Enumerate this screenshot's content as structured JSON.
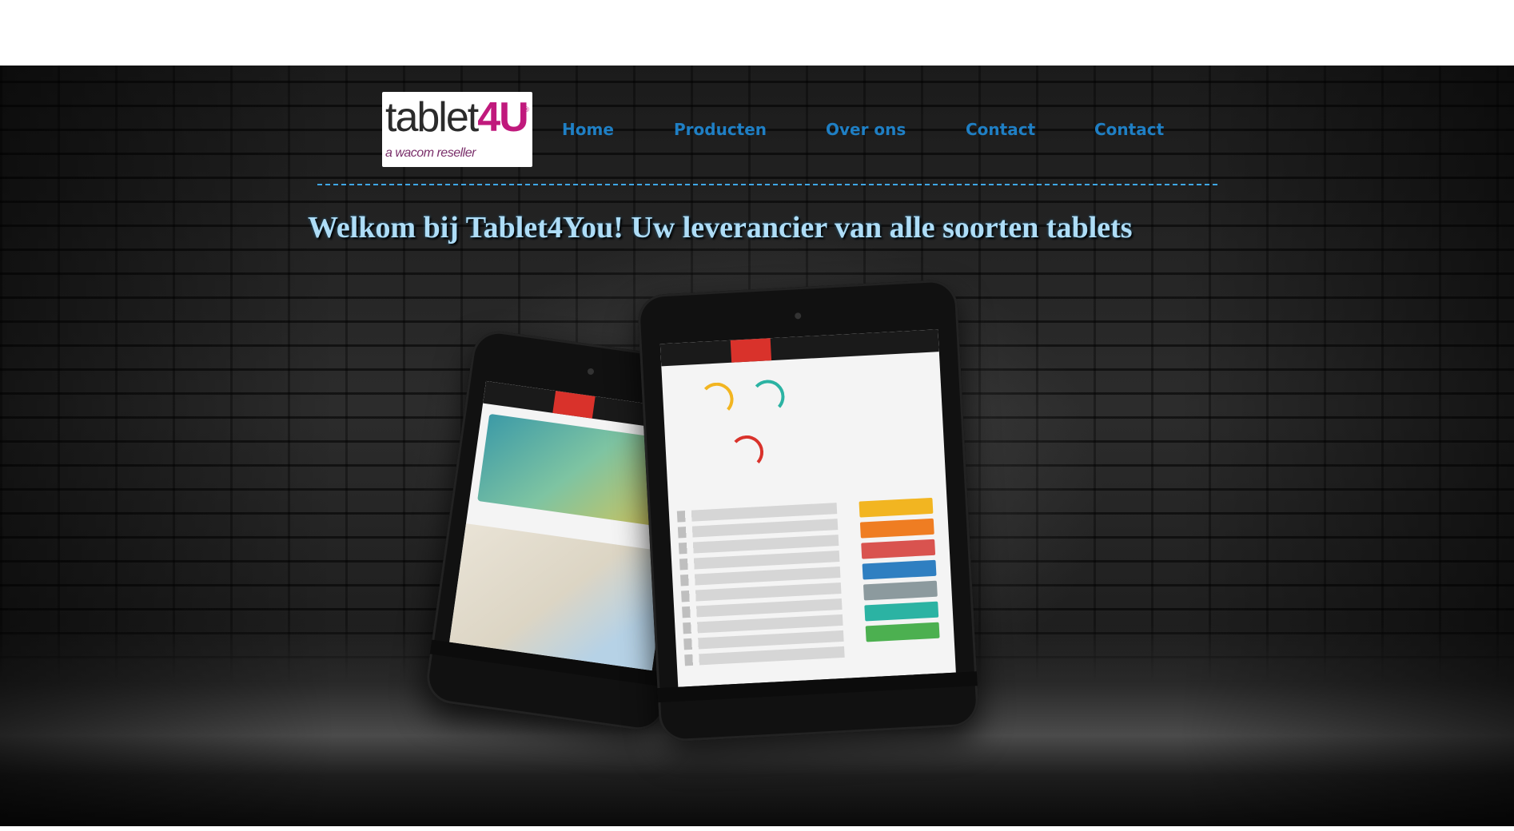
{
  "logo": {
    "text_main": "tablet",
    "text_accent": "4U",
    "tagline": "a wacom reseller",
    "registered": "®"
  },
  "nav": {
    "items": [
      {
        "label": "Home"
      },
      {
        "label": "Producten"
      },
      {
        "label": "Over ons"
      },
      {
        "label": "Contact"
      },
      {
        "label": "Contact"
      }
    ]
  },
  "hero": {
    "headline": "Welkom bij Tablet4You! Uw leverancier van alle soorten tablets"
  },
  "colors": {
    "nav_link": "#1f7fc4",
    "divider": "#3fa7e6",
    "headline": "#aeddf7",
    "logo_accent": "#c0197c"
  }
}
